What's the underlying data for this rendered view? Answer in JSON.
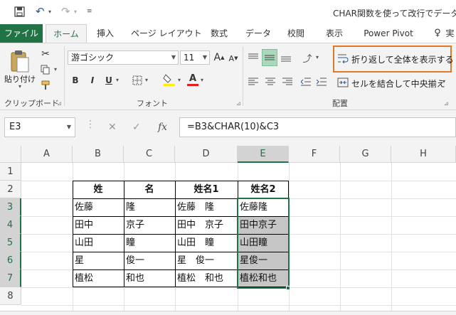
{
  "window": {
    "title": "CHAR関数を使って改行でデータを連"
  },
  "ribbon_tabs": [
    {
      "label": "ファイル"
    },
    {
      "label": "ホーム"
    },
    {
      "label": "挿入"
    },
    {
      "label": "ページ レイアウト"
    },
    {
      "label": "数式"
    },
    {
      "label": "データ"
    },
    {
      "label": "校閲"
    },
    {
      "label": "表示"
    },
    {
      "label": "Power Pivot"
    },
    {
      "label": "実"
    }
  ],
  "clipboard": {
    "paste_label": "貼り付け",
    "group_label": "クリップボード"
  },
  "font": {
    "family": "游ゴシック",
    "size": "11",
    "size_up": "A",
    "size_down": "A",
    "bold": "B",
    "italic": "I",
    "underline": "U",
    "font_color": "A",
    "group_label": "フォント"
  },
  "alignment": {
    "wrap_text_label": "折り返して全体を表示する",
    "merge_center_label": "セルを結合して中央揃え",
    "group_label": "配置"
  },
  "formula_bar": {
    "name_box": "E3",
    "fx": "fx",
    "formula": "=B3&CHAR(10)&C3"
  },
  "columns": [
    "A",
    "B",
    "C",
    "D",
    "E",
    "F",
    "G",
    "H"
  ],
  "rows": [
    "1",
    "2",
    "3",
    "4",
    "5",
    "6",
    "7",
    "8"
  ],
  "table": {
    "headers": [
      "姓",
      "名",
      "姓名1",
      "姓名2"
    ],
    "rows": [
      [
        "佐藤",
        "隆",
        "佐藤　隆",
        "佐藤隆"
      ],
      [
        "田中",
        "京子",
        "田中　京子",
        "田中京子"
      ],
      [
        "山田",
        "瞳",
        "山田　瞳",
        "山田瞳"
      ],
      [
        "星",
        "俊一",
        "星　俊一",
        "星俊一"
      ],
      [
        "植松",
        "和也",
        "植松　和也",
        "植松和也"
      ]
    ]
  },
  "colors": {
    "excel_green": "#217346",
    "highlight_orange": "#e07a26",
    "selection_fill": "#c6c6c6",
    "ribbon_bg": "#f3f3f3"
  }
}
